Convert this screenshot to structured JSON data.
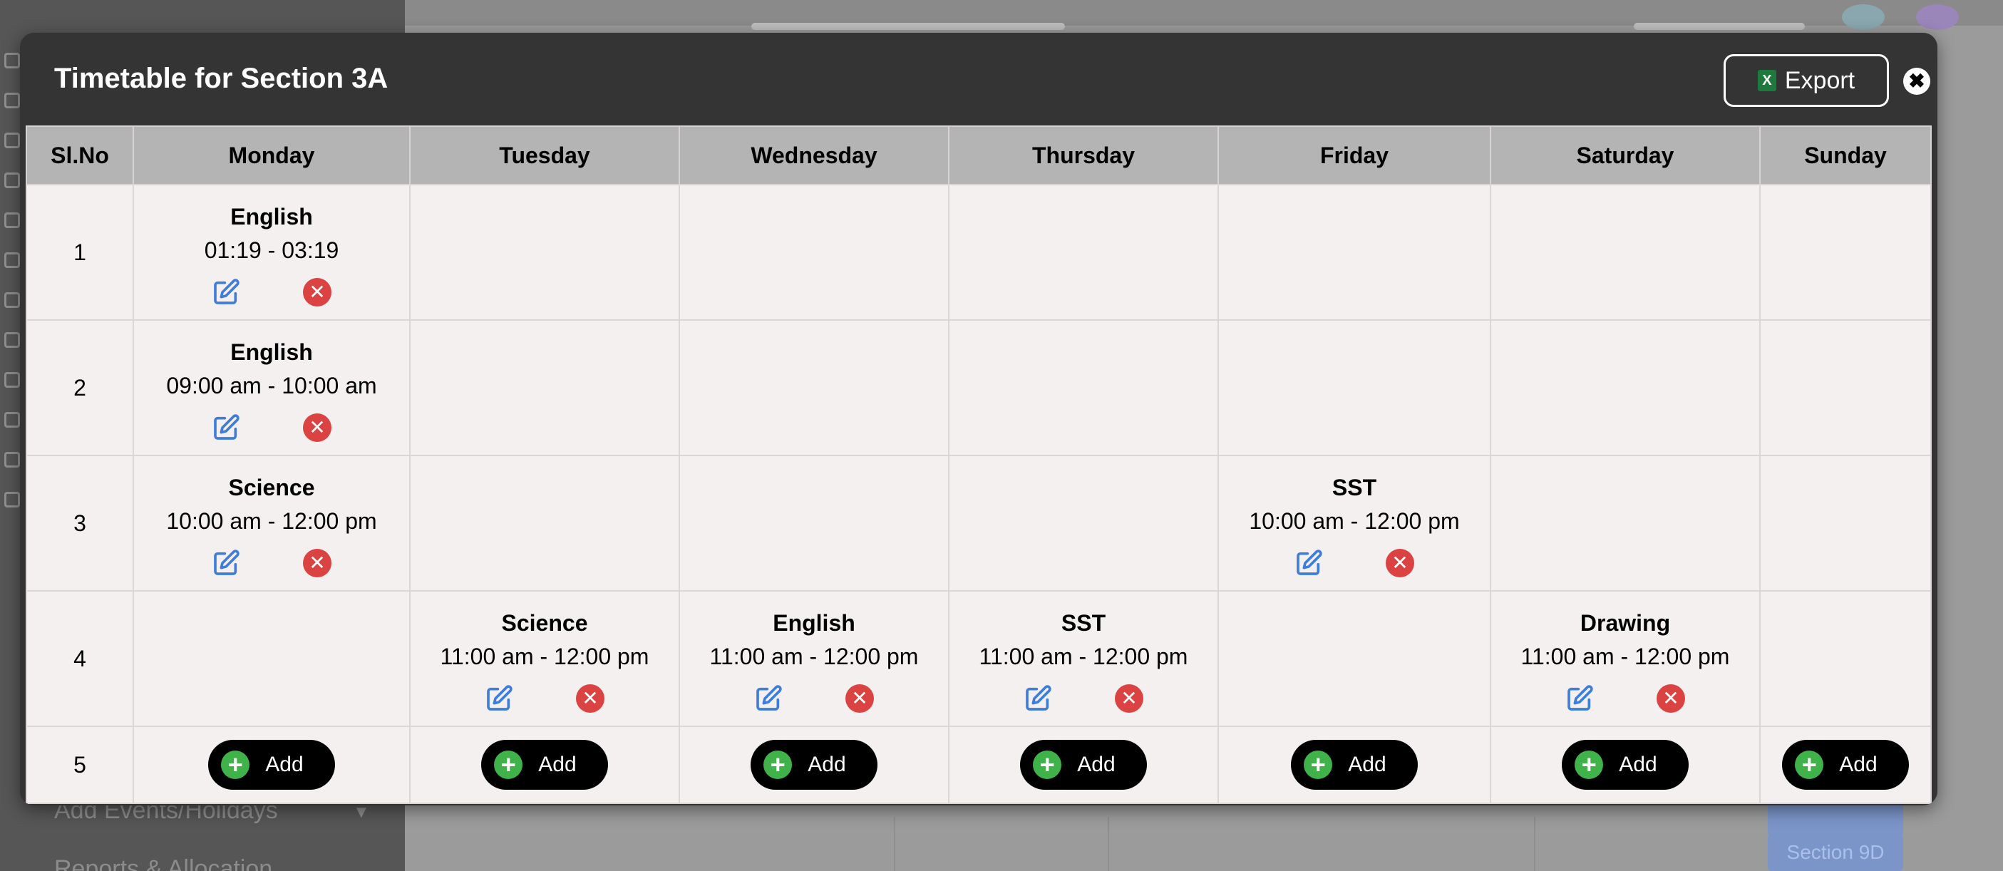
{
  "background": {
    "sidebar_items": [
      "Add Events/Holidays",
      "Reports & Allocation"
    ],
    "sections": [
      "Section 9D"
    ]
  },
  "modal": {
    "title": "Timetable for Section 3A",
    "export_label": "Export",
    "close_glyph": "✖"
  },
  "table": {
    "headers": [
      "Sl.No",
      "Monday",
      "Tuesday",
      "Wednesday",
      "Thursday",
      "Friday",
      "Saturday",
      "Sunday"
    ],
    "rows": [
      {
        "no": "1",
        "cells": [
          {
            "subject": "English",
            "time": "01:19 - 03:19"
          },
          null,
          null,
          null,
          null,
          null,
          null
        ]
      },
      {
        "no": "2",
        "cells": [
          {
            "subject": "English",
            "time": "09:00 am - 10:00 am"
          },
          null,
          null,
          null,
          null,
          null,
          null
        ]
      },
      {
        "no": "3",
        "cells": [
          {
            "subject": "Science",
            "time": "10:00 am - 12:00 pm"
          },
          null,
          null,
          null,
          {
            "subject": "SST",
            "time": "10:00 am - 12:00 pm"
          },
          null,
          null
        ]
      },
      {
        "no": "4",
        "cells": [
          null,
          {
            "subject": "Science",
            "time": "11:00 am - 12:00 pm"
          },
          {
            "subject": "English",
            "time": "11:00 am - 12:00 pm"
          },
          {
            "subject": "SST",
            "time": "11:00 am - 12:00 pm"
          },
          null,
          {
            "subject": "Drawing",
            "time": "11:00 am - 12:00 pm"
          },
          null
        ]
      }
    ],
    "add_row_no": "5",
    "add_label": "Add",
    "edit_icon": "edit-icon",
    "delete_icon": "delete-icon",
    "plus_icon": "plus-icon"
  },
  "colors": {
    "modal_bg": "#343434",
    "header_bg": "#b4b4b4",
    "cell_bg": "#f4f0f0",
    "edit_blue": "#3f7ddb",
    "delete_red": "#db4343",
    "add_green": "#3fb24a"
  }
}
